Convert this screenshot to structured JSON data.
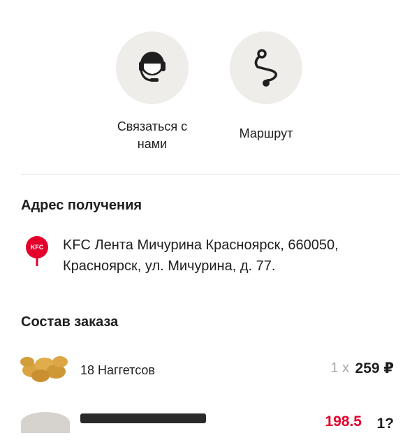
{
  "actions": {
    "contact": {
      "label": "Связаться с нами",
      "icon": "headset-icon"
    },
    "route": {
      "label": "Маршрут",
      "icon": "route-icon"
    }
  },
  "address_section": {
    "title": "Адрес получения",
    "pin_icon": "kfc-pin-icon",
    "pin_text": "KFC",
    "address": "KFC Лента Мичурина Красноярск, 660050, Красноярск, ул. Мичурина, д. 77."
  },
  "order_section": {
    "title": "Состав заказа",
    "items": [
      {
        "name": "18 Наггетсов",
        "qty": "1 x",
        "price": "259 ₽",
        "thumb_icon": "nuggets-image"
      },
      {
        "name": "",
        "qty": "",
        "old_price": "198.5",
        "price": "1?",
        "thumb_icon": "product-image"
      }
    ]
  },
  "colors": {
    "accent": "#e4002b",
    "circle_bg": "#efedea",
    "muted": "#a8a8a8",
    "text": "#1f1f1f"
  }
}
